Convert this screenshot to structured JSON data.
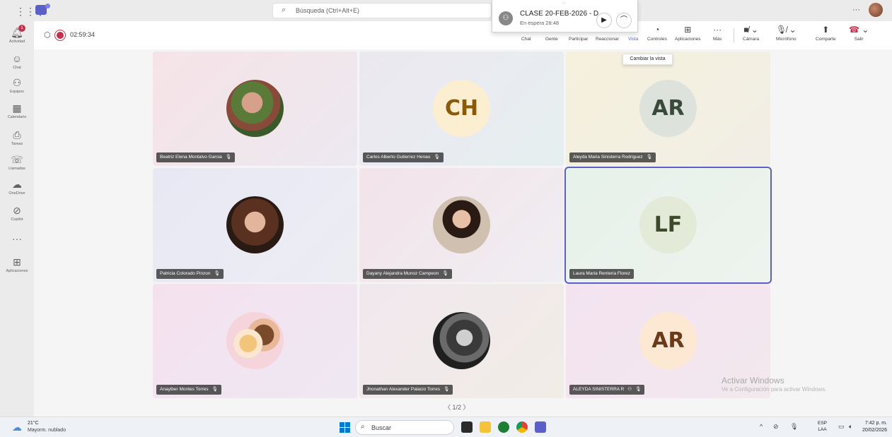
{
  "titlebar": {
    "search_placeholder": "Búsqueda (Ctrl+Alt+E)",
    "more": "···"
  },
  "popup": {
    "grip": "···",
    "title": "CLASE 20-FEB-2026 - D",
    "status": "En espera  28:48"
  },
  "rail": {
    "items": [
      {
        "label": "Actividad",
        "icon": "bell-icon",
        "badge": "1"
      },
      {
        "label": "Chat",
        "icon": "chat-icon"
      },
      {
        "label": "Equipos",
        "icon": "teams-icon"
      },
      {
        "label": "Calendario",
        "icon": "calendar-icon"
      },
      {
        "label": "Tareas",
        "icon": "tasks-icon"
      },
      {
        "label": "Llamadas",
        "icon": "phone-icon"
      },
      {
        "label": "OneDrive",
        "icon": "cloud-icon"
      },
      {
        "label": "Copilot",
        "icon": "copilot-icon"
      },
      {
        "label": "···",
        "icon": "more-icon"
      },
      {
        "label": "Aplicaciones",
        "icon": "plus-icon"
      }
    ]
  },
  "meeting": {
    "timer": "02:59:34",
    "controls": {
      "chat": "Chat",
      "people": "Gente",
      "raise": "Participar",
      "react": "Reaccionar",
      "view": "Vista",
      "controls": "Controles",
      "apps": "Aplicaciones",
      "more": "Más",
      "camera": "Cámara",
      "mic": "Micrófono",
      "share": "Comparte",
      "leave": "Salir"
    },
    "tooltip": "Cambiar la vista",
    "accent_color": "#5b5fc7",
    "leave_color": "#c4314b"
  },
  "participants": [
    {
      "name": "Beatriz Elena Montalvo Garcia",
      "type": "photo"
    },
    {
      "name": "Carlos Alberto Gutierrez Henao",
      "type": "initials",
      "initials": "CH"
    },
    {
      "name": "Aleyda Maria Sinisterra Rodriguez",
      "type": "initials",
      "initials": "AR"
    },
    {
      "name": "Patricia Colorado Pinzon",
      "type": "photo"
    },
    {
      "name": "Dayany Alejandra Munoz Campeon",
      "type": "photo"
    },
    {
      "name": "Laura Maria Renteria Florez",
      "type": "initials",
      "initials": "LF",
      "speaking": true
    },
    {
      "name": "Anayiber Montes Torres",
      "type": "photo"
    },
    {
      "name": "Jhonathan Alexander Palacio Torres",
      "type": "photo"
    },
    {
      "name": "ALEYDA SINISTERRA R",
      "type": "initials",
      "initials": "AR"
    }
  ],
  "pager": "〈  1/2  〉",
  "watermark": {
    "title": "Activar Windows",
    "subtitle": "Ve a Configuración para activar Windows."
  },
  "taskbar": {
    "temp": "21°C",
    "weather": "Mayorm. nublado",
    "search": "Buscar",
    "lang_top": "ESP",
    "lang_bottom": "LAA",
    "time": "7:42 p. m.",
    "date": "20/02/2026"
  }
}
